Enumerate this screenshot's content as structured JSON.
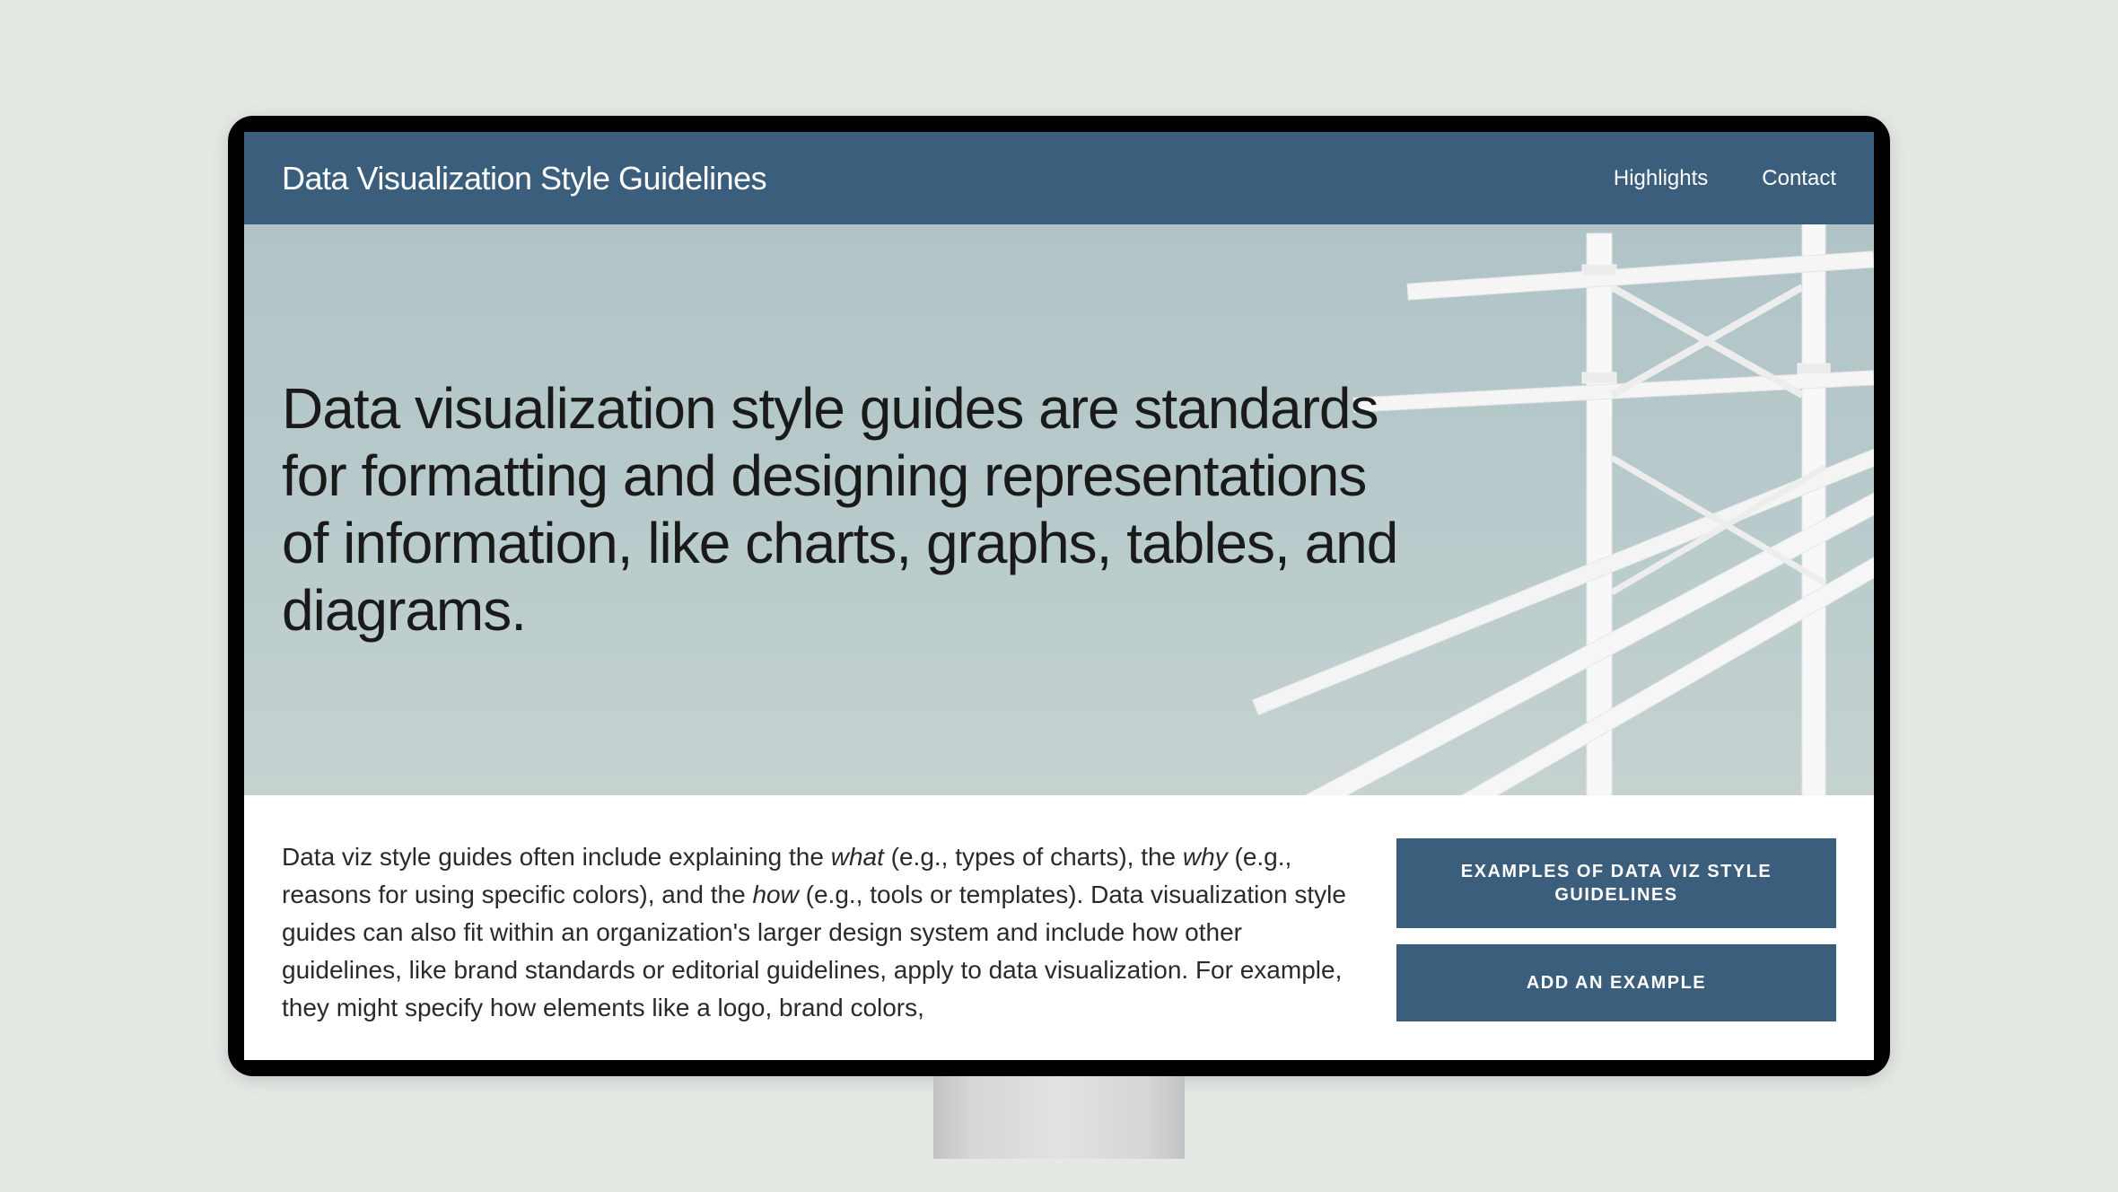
{
  "header": {
    "title": "Data Visualization Style Guidelines",
    "nav": {
      "highlights": "Highlights",
      "contact": "Contact"
    }
  },
  "hero": {
    "heading": "Data visualization style guides are standards for formatting and designing representations of information, like charts, graphs, tables, and diagrams."
  },
  "content": {
    "body_pre": "Data viz style guides often include explaining the ",
    "body_what": "what",
    "body_mid1": " (e.g., types of charts), the ",
    "body_why": "why",
    "body_mid2": " (e.g., reasons for using specific colors), and the ",
    "body_how": "how",
    "body_post": " (e.g., tools or templates). Data visualization style guides can also fit within an organization's larger design system and include how other guidelines, like brand standards or editorial guidelines, apply to data visualization. For example, they might specify how elements like a logo, brand colors,"
  },
  "cta": {
    "examples": "EXAMPLES OF DATA VIZ STYLE GUIDELINES",
    "add": "ADD AN EXAMPLE"
  }
}
